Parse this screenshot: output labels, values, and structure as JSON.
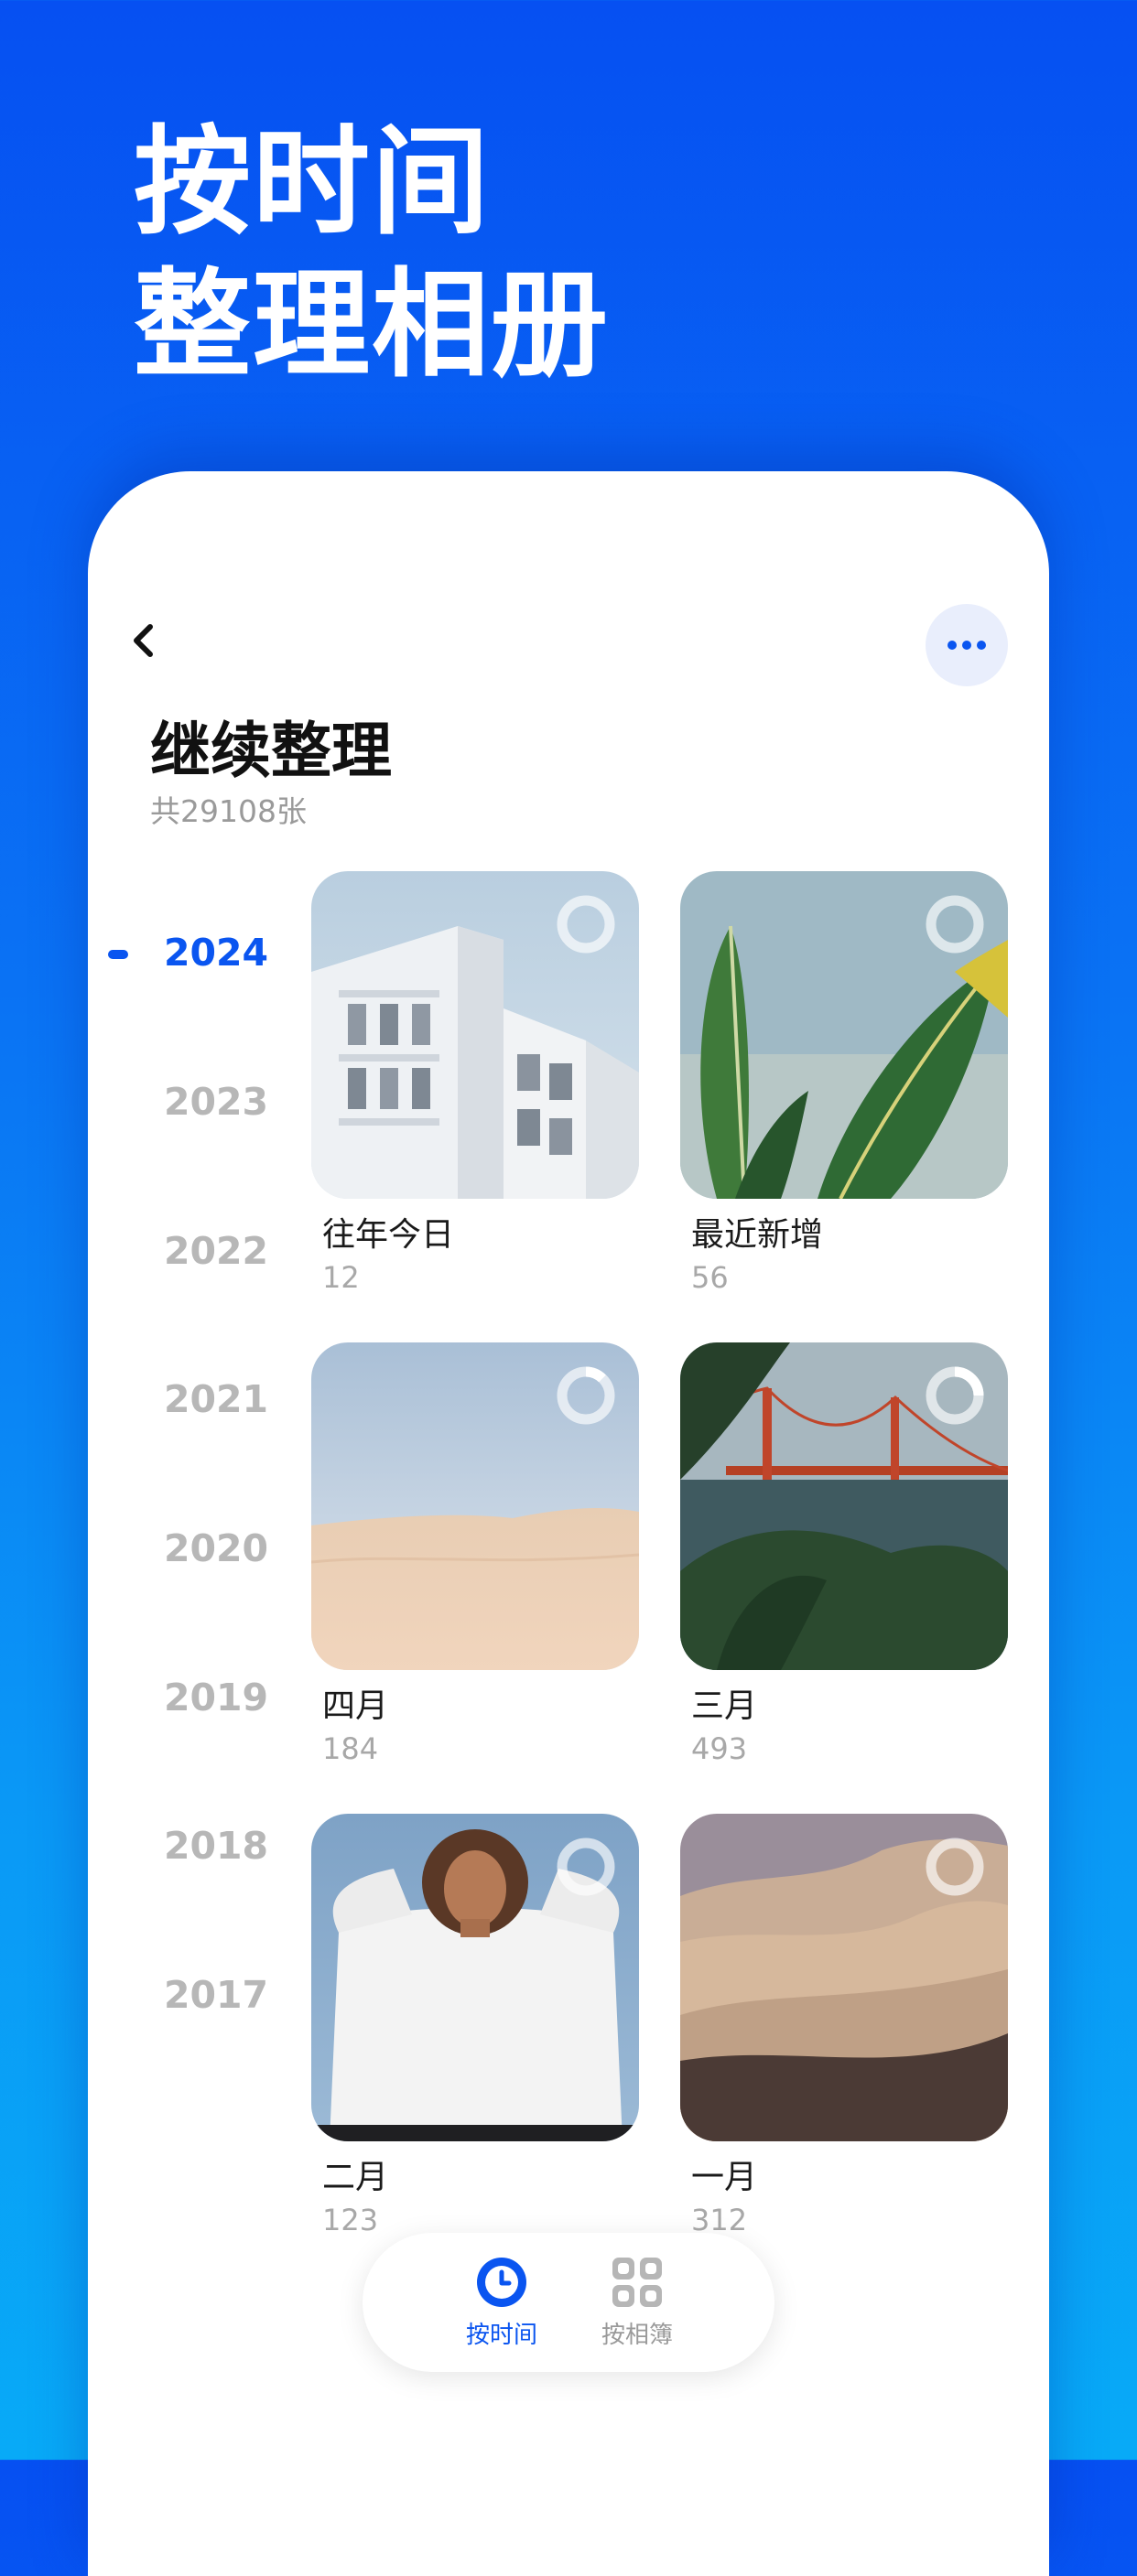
{
  "hero": {
    "line1": "按时间",
    "line2": "整理相册"
  },
  "header": {
    "back_icon": "chevron-left-icon",
    "more_icon": "ellipsis-icon",
    "title": "继续整理",
    "subtitle": "共29108张"
  },
  "years": {
    "active": "2024",
    "items": [
      "2024",
      "2023",
      "2022",
      "2021",
      "2020",
      "2019",
      "2018",
      "2017"
    ]
  },
  "albums": [
    {
      "name": "往年今日",
      "count": "12",
      "progress": 0
    },
    {
      "name": "最近新增",
      "count": "56",
      "progress": 0
    },
    {
      "name": "四月",
      "count": "184",
      "progress": 0.12
    },
    {
      "name": "三月",
      "count": "493",
      "progress": 0.22
    },
    {
      "name": "二月",
      "count": "123",
      "progress": 0
    },
    {
      "name": "一月",
      "count": "312",
      "progress": 0
    }
  ],
  "tabbar": {
    "tabs": [
      {
        "label": "按时间",
        "icon": "clock-icon",
        "active": true
      },
      {
        "label": "按相簿",
        "icon": "grid-icon",
        "active": false
      }
    ]
  },
  "colors": {
    "accent": "#0a55f0",
    "inactive_year": "#b7b7b7",
    "count_gray": "#a8a8a8",
    "more_button_bg": "#e9eefc"
  }
}
